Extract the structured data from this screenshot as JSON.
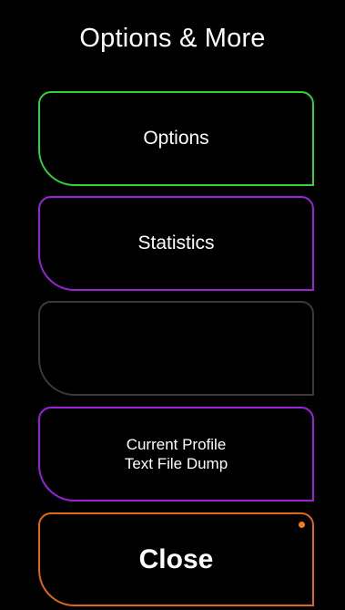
{
  "title": "Options & More",
  "colors": {
    "background": "#000000",
    "text": "#ffffff",
    "options_border": "#2ed23a",
    "statistics_border": "#9b22d6",
    "empty_border": "#3a3a3a",
    "dump_border": "#9b22d6",
    "close_border": "#e0661a",
    "close_dot": "#f07a1e"
  },
  "buttons": {
    "options": "Options",
    "statistics": "Statistics",
    "empty": "",
    "dump_line1": "Current Profile",
    "dump_line2": "Text File Dump",
    "close": "Close"
  },
  "icons": {
    "close_indicator": "dot-indicator"
  }
}
